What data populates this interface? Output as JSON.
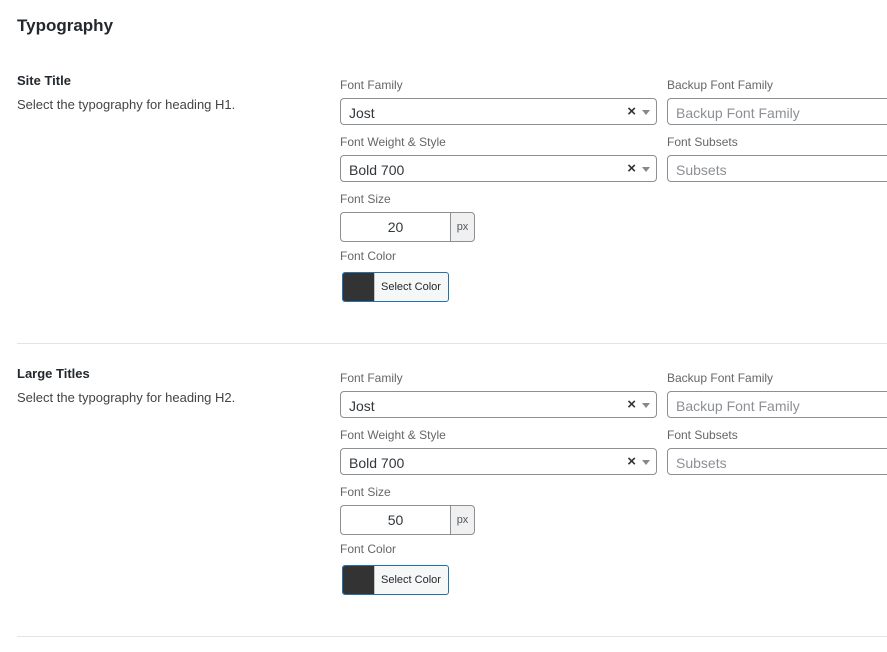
{
  "page": {
    "title": "Typography"
  },
  "sections": [
    {
      "heading": "Site Title",
      "description": "Select the typography for heading H1.",
      "font_family_label": "Font Family",
      "font_family_value": "Jost",
      "backup_font_family_label": "Backup Font Family",
      "backup_font_family_placeholder": "Backup Font Family",
      "font_weight_label": "Font Weight & Style",
      "font_weight_value": "Bold 700",
      "font_subsets_label": "Font Subsets",
      "font_subsets_placeholder": "Subsets",
      "font_size_label": "Font Size",
      "font_size_value": "20",
      "font_size_unit": "px",
      "font_color_label": "Font Color",
      "font_color_button": "Select Color",
      "font_color_hex": "#333333",
      "clear_glyph": "×"
    },
    {
      "heading": "Large Titles",
      "description": "Select the typography for heading H2.",
      "font_family_label": "Font Family",
      "font_family_value": "Jost",
      "backup_font_family_label": "Backup Font Family",
      "backup_font_family_placeholder": "Backup Font Family",
      "font_weight_label": "Font Weight & Style",
      "font_weight_value": "Bold 700",
      "font_subsets_label": "Font Subsets",
      "font_subsets_placeholder": "Subsets",
      "font_size_label": "Font Size",
      "font_size_value": "50",
      "font_size_unit": "px",
      "font_color_label": "Font Color",
      "font_color_button": "Select Color",
      "font_color_hex": "#333333",
      "clear_glyph": "×"
    }
  ],
  "colors": {
    "accent_border": "#2271b1",
    "text_primary": "#23282d",
    "divider": "#e4e4e4"
  },
  "icons": {
    "clear": "close-icon",
    "dropdown": "chevron-down-icon"
  }
}
